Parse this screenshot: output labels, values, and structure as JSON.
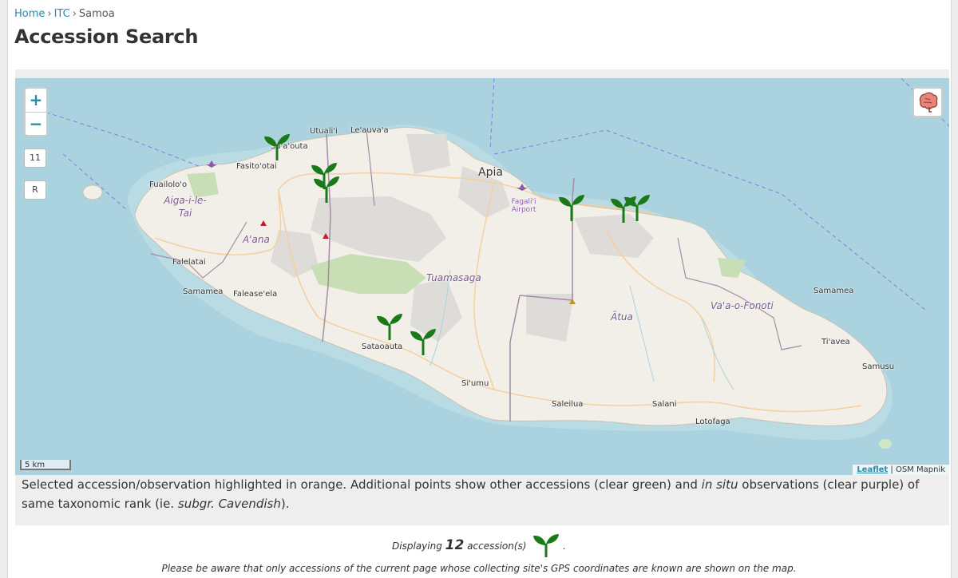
{
  "breadcrumb": {
    "home": "Home",
    "itc": "ITC",
    "current": "Samoa",
    "separator": "›"
  },
  "page_title": "Accession Search",
  "map": {
    "zoom_in": "+",
    "zoom_out": "−",
    "zoom_level": "11",
    "reset_label": "R",
    "layer_icon": "brain-layers-icon",
    "scale_label": "5 km",
    "attribution_leaflet": "Leaflet",
    "attribution_separator": "|",
    "attribution_tiles": "OSM Mapnik",
    "labels": {
      "apia": "Apia",
      "utualii": "Utuali'i",
      "leauvaa": "Le'auva'a",
      "fasitootai": "Fasito'otai",
      "saaouta": "Sa'a'outa",
      "fuailoloo": "Fuailolo'o",
      "aigailetai": "Aiga-i-le-Tai",
      "aana": "A'ana",
      "falelatai": "Falelatai",
      "faleaseela": "Falease'ela",
      "tuamasaga": "Tuamasaga",
      "faleolo_airport": "Fagali'i Airport",
      "samamea": "Samamea",
      "vaaofonoti": "Va'a-o-Fonoti",
      "atua": "Ātua",
      "tiavea": "Ti'avea",
      "samusu": "Samusu",
      "sataoauta": "Sataoauta",
      "siumu": "Si'umu",
      "saleilua": "Saleilua",
      "salani": "Salani",
      "lotofaga": "Lotofaga"
    },
    "marker_color": "#1a7a1a",
    "sea_color": "#aad3df",
    "land_color": "#f2efe9"
  },
  "caption": {
    "part1": "Selected accession/observation highlighted in orange. Additional points show other accessions (clear green) and ",
    "insitu": "in situ",
    "part2": " observations (clear purple) of same taxonomic rank (ie. ",
    "taxon": "subgr. Cavendish",
    "part3": ")."
  },
  "results": {
    "prefix": "Displaying",
    "count": "12",
    "suffix": "accession(s)",
    "end": ".",
    "icon": "plant-sprout-icon",
    "notice": "Please be aware that only accessions of the current page whose collecting site's GPS coordinates are known are shown on the map."
  }
}
